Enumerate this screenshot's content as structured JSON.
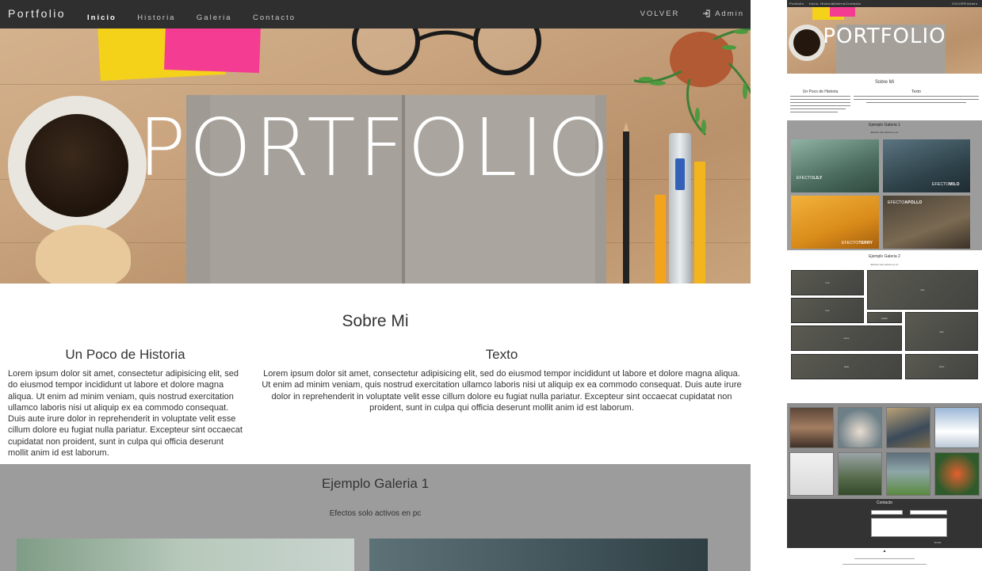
{
  "navbar": {
    "brand": "Portfolio",
    "links": [
      "Inicio",
      "Historia",
      "Galeria",
      "Contacto"
    ],
    "volver": "VOLVER",
    "admin": "Admin"
  },
  "hero": {
    "title": "PORTFOLIO"
  },
  "sobre": {
    "title": "Sobre Mi",
    "left_title": "Un Poco de Historia",
    "left_text": "Lorem ipsum dolor sit amet, consectetur adipisicing elit, sed do eiusmod tempor incididunt ut labore et dolore magna aliqua. Ut enim ad minim veniam, quis nostrud exercitation ullamco laboris nisi ut aliquip ex ea commodo consequat. Duis aute irure dolor in reprehenderit in voluptate velit esse cillum dolore eu fugiat nulla pariatur. Excepteur sint occaecat cupidatat non proident, sunt in culpa qui officia deserunt mollit anim id est laborum.",
    "right_title": "Texto",
    "right_text": "Lorem ipsum dolor sit amet, consectetur adipisicing elit, sed do eiusmod tempor incididunt ut labore et dolore magna aliqua. Ut enim ad minim veniam, quis nostrud exercitation ullamco laboris nisi ut aliquip ex ea commodo consequat. Duis aute irure dolor in reprehenderit in voluptate velit esse cillum dolore eu fugiat nulla pariatur. Excepteur sint occaecat cupidatat non proident, sunt in culpa qui officia deserunt mollit anim id est laborum."
  },
  "gallery1": {
    "title": "Ejemplo Galeria 1",
    "subtitle": "Efectos solo activos en pc"
  },
  "thumbnail": {
    "brand": "Portfolio",
    "links": [
      "Inicio",
      "Historia",
      "Galeria",
      "Contacto"
    ],
    "volver": "VOLVER",
    "admin": "Admin",
    "hero_title": "PORTFOLIO",
    "sobre_title": "Sobre Mi",
    "left_title": "Un Poco de Historia",
    "right_title": "Texto",
    "gallery1_title": "Ejemplo Galeria 1",
    "gallery1_effects": [
      {
        "prefix": "EFECTO",
        "name": "LILY"
      },
      {
        "prefix": "EFECTO",
        "name": "MILO"
      },
      {
        "prefix": "EFECTO",
        "name": "TERRY"
      },
      {
        "prefix": "EFECTO",
        "name": "APOLLO"
      }
    ],
    "gallery2_title": "Ejemplo Galeria 2",
    "gallery2_tiles": [
      "uno",
      "dos",
      "tres",
      "cuatro",
      "cinco",
      "seis",
      "siete",
      "ocho"
    ],
    "contact_title": "Contacto",
    "send_label": "Enviar"
  },
  "colors": {
    "navbar": "#2f2f2f",
    "gallery_bg": "#9c9c9c",
    "contact_bg": "#333333"
  }
}
